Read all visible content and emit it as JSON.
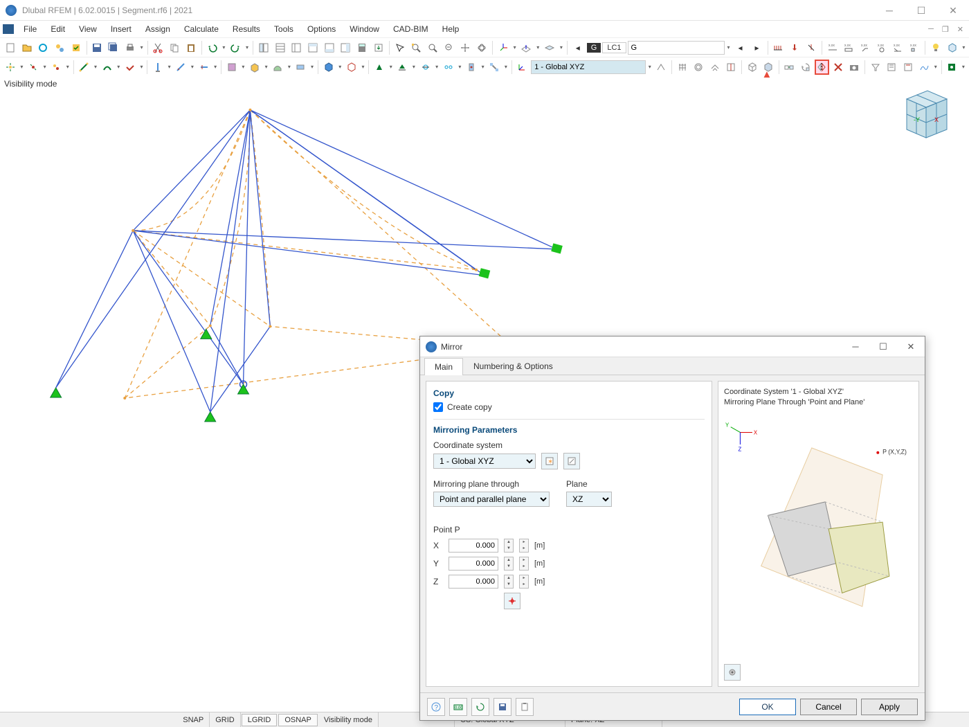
{
  "titlebar": {
    "text": "Dlubal RFEM | 6.02.0015 | Segment.rf6 | 2021"
  },
  "menu": {
    "items": [
      "File",
      "Edit",
      "View",
      "Insert",
      "Assign",
      "Calculate",
      "Results",
      "Tools",
      "Options",
      "Window",
      "CAD-BIM",
      "Help"
    ]
  },
  "toolbar1": {
    "load_case": {
      "badge1": "G",
      "badge2": "LC1",
      "value": "G"
    }
  },
  "toolbar2": {
    "coord_system": "1 - Global XYZ"
  },
  "viewport": {
    "label": "Visibility mode"
  },
  "statusbar": {
    "snap": "SNAP",
    "grid": "GRID",
    "lgrid": "LGRID",
    "osnap": "OSNAP",
    "vismode": "Visibility mode",
    "cs": "CS: Global XYZ",
    "plane": "Plane: XZ"
  },
  "dialog": {
    "title": "Mirror",
    "tabs": [
      "Main",
      "Numbering & Options"
    ],
    "copy_section": "Copy",
    "create_copy": "Create copy",
    "mirroring_section": "Mirroring Parameters",
    "cs_label": "Coordinate system",
    "cs_value": "1 - Global XYZ",
    "plane_through_label": "Mirroring plane through",
    "plane_through_value": "Point and parallel plane",
    "plane_label": "Plane",
    "plane_value": "XZ",
    "point_label": "Point P",
    "x_label": "X",
    "y_label": "Y",
    "z_label": "Z",
    "x": "0.000",
    "y": "0.000",
    "z": "0.000",
    "unit": "[m]",
    "preview_line1": "Coordinate System '1 - Global XYZ'",
    "preview_line2": "Mirroring Plane Through 'Point and Plane'",
    "point_marker": "P (X,Y,Z)",
    "ok": "OK",
    "cancel": "Cancel",
    "apply": "Apply"
  }
}
